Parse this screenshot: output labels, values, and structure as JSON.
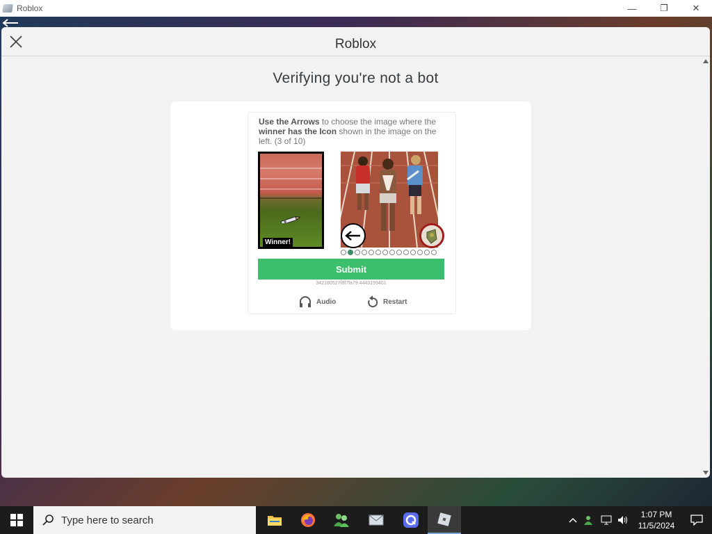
{
  "window": {
    "title": "Roblox",
    "minimize": "—",
    "restore": "❐",
    "close": "✕"
  },
  "modal": {
    "title": "Roblox",
    "heading": "Verifying you're not a bot"
  },
  "captcha": {
    "instruction_bold_1": "Use the Arrows",
    "instruction_text_1": " to choose the image where the ",
    "instruction_bold_2": "winner has the Icon",
    "instruction_text_2": " shown in the image on the left. (3 of 10)",
    "winner_label": "Winner!",
    "total_dots": 14,
    "active_dot": 1,
    "submit_label": "Submit",
    "session_id": "342180527f8f7fa79.4443159401",
    "audio_label": "Audio",
    "restart_label": "Restart"
  },
  "taskbar": {
    "search_placeholder": "Type here to search",
    "apps": [
      "file-explorer",
      "firefox",
      "people",
      "mail",
      "app-launcher",
      "roblox"
    ],
    "time": "1:07 PM",
    "date": "11/5/2024"
  },
  "colors": {
    "submit": "#3cbf6d",
    "active_dot": "#3e8b6b"
  }
}
